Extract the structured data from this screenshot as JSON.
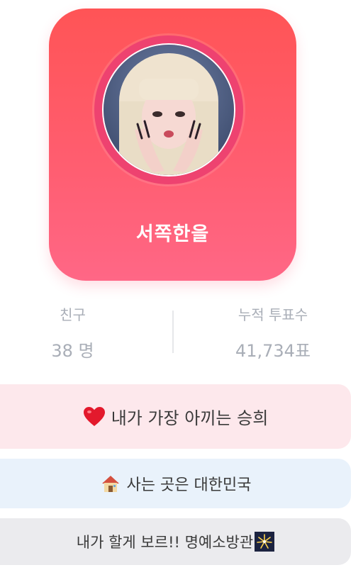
{
  "profile": {
    "nickname": "서쪽한을",
    "avatar_icon": "profile-photo"
  },
  "stats": {
    "friends_label": "친구",
    "friends_value": "38 명",
    "votes_label": "누적 투표수",
    "votes_value": "41,734표"
  },
  "bars": [
    {
      "icon": "heart-icon",
      "text": "내가 가장 아끼는 승희"
    },
    {
      "icon": "house-icon",
      "text": "사는 곳은 대한민국"
    },
    {
      "icon": "fireworks-icon",
      "text": "내가 할게 보르!! 명예소방관"
    }
  ],
  "colors": {
    "card_top": "#ff5456",
    "card_bottom": "#ff6786",
    "ring": "#ee4270",
    "bar_1": "#fde8ec",
    "bar_2": "#e9f2fb",
    "bar_3": "#ebebee",
    "stat_text": "#a9aeb7"
  }
}
